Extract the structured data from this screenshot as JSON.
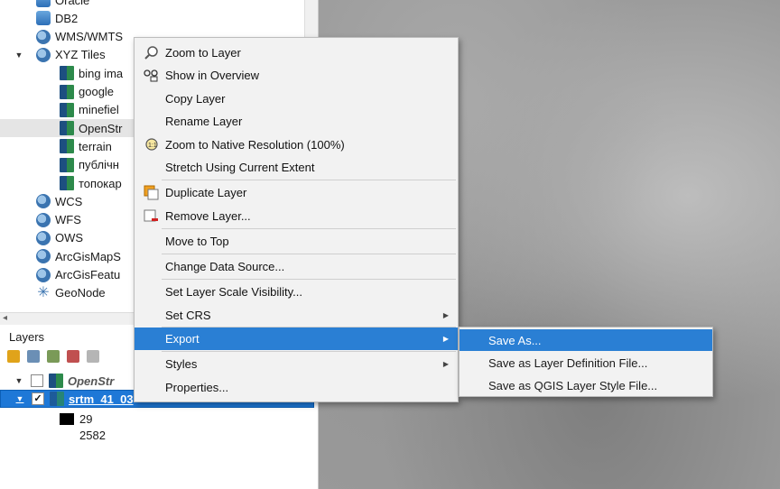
{
  "browser": {
    "items": [
      {
        "label": "Oracle",
        "icon": "database-icon",
        "indent": 1,
        "caret": ""
      },
      {
        "label": "DB2",
        "icon": "database-icon",
        "indent": 1,
        "caret": ""
      },
      {
        "label": "WMS/WMTS",
        "icon": "globe-icon",
        "indent": 1,
        "caret": ""
      },
      {
        "label": "XYZ Tiles",
        "icon": "globe-icon",
        "indent": 1,
        "caret": "▼"
      },
      {
        "label": "bing ima",
        "icon": "tile-layer-icon",
        "indent": 2,
        "caret": ""
      },
      {
        "label": "google",
        "icon": "tile-layer-icon",
        "indent": 2,
        "caret": ""
      },
      {
        "label": "minefiel",
        "icon": "tile-layer-icon",
        "indent": 2,
        "caret": ""
      },
      {
        "label": "OpenStr",
        "icon": "tile-layer-icon",
        "indent": 2,
        "caret": ""
      },
      {
        "label": "terrain",
        "icon": "tile-layer-icon",
        "indent": 2,
        "caret": ""
      },
      {
        "label": "публічн",
        "icon": "tile-layer-icon",
        "indent": 2,
        "caret": ""
      },
      {
        "label": "топокар",
        "icon": "tile-layer-icon",
        "indent": 2,
        "caret": ""
      },
      {
        "label": "WCS",
        "icon": "globe-icon",
        "indent": 1,
        "caret": ""
      },
      {
        "label": "WFS",
        "icon": "globe-icon",
        "indent": 1,
        "caret": ""
      },
      {
        "label": "OWS",
        "icon": "globe-icon",
        "indent": 1,
        "caret": ""
      },
      {
        "label": "ArcGisMapS",
        "icon": "globe-icon",
        "indent": 1,
        "caret": ""
      },
      {
        "label": "ArcGisFeatu",
        "icon": "globe-icon",
        "indent": 1,
        "caret": ""
      },
      {
        "label": "GeoNode",
        "icon": "geonode-icon",
        "indent": 1,
        "caret": ""
      }
    ],
    "scroll_left_arrow": "◂"
  },
  "layers": {
    "title": "Layers",
    "rows": [
      {
        "label": "OpenStr",
        "checked": "",
        "caret": "▼"
      },
      {
        "label": "srtm_41_03",
        "checked": "✓",
        "caret": "▼"
      }
    ],
    "legend": {
      "high": "29",
      "low": "2582"
    }
  },
  "context_menu": {
    "zoom_to_layer": "Zoom to Layer",
    "show_in_overview": "Show in Overview",
    "copy_layer": "Copy Layer",
    "rename_layer": "Rename Layer",
    "zoom_native": "Zoom to Native Resolution (100%)",
    "stretch_extent": "Stretch Using Current Extent",
    "duplicate_layer": "Duplicate Layer",
    "remove_layer": "Remove Layer...",
    "move_to_top": "Move to Top",
    "change_data_source": "Change Data Source...",
    "set_scale_visibility": "Set Layer Scale Visibility...",
    "set_crs": "Set CRS",
    "export": "Export",
    "styles": "Styles",
    "properties": "Properties...",
    "submenu_arrow": "▶"
  },
  "export_submenu": {
    "save_as": "Save As...",
    "save_layer_definition": "Save as Layer Definition File...",
    "save_qgis_style": "Save as QGIS Layer Style File..."
  },
  "colors": {
    "highlight": "#2a7fd4",
    "menu_bg": "#f2f2f2"
  }
}
